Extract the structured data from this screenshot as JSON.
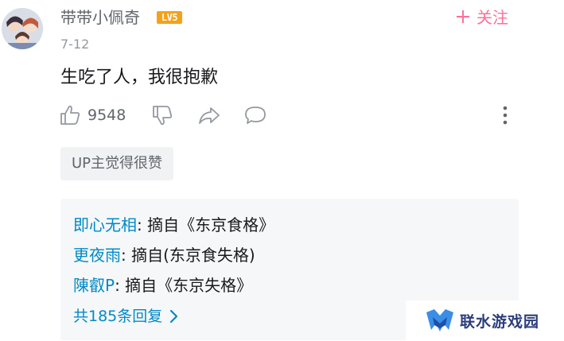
{
  "comment": {
    "username": "带带小佩奇",
    "level": "LV5",
    "follow_label": "关注",
    "follow_icon": "plus-icon",
    "date": "7-12",
    "text": "生吃了人，我很抱歉",
    "like_count": "9548",
    "up_liked_tag": "UP主觉得很赞"
  },
  "replies": {
    "items": [
      {
        "name": "即心无相",
        "text": ": 摘自《东京食格》"
      },
      {
        "name": "更夜雨",
        "text": ": 摘自(东京食失格)"
      },
      {
        "name": "陳叡P",
        "text": ": 摘自《东京失格》"
      }
    ],
    "more_label": "共185条回复"
  },
  "watermark": {
    "text": "联水游戏园"
  },
  "colors": {
    "accent_pink": "#fb7299",
    "link_blue": "#008ac5",
    "level_orange": "#f6a11a",
    "secondary_text": "#61666d",
    "reply_bg": "#f6f7f8"
  }
}
